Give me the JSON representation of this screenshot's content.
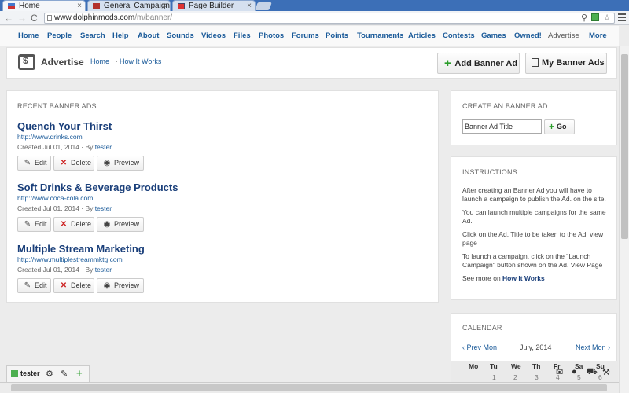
{
  "browser": {
    "tabs": [
      {
        "label": "Home",
        "active": true
      },
      {
        "label": "General Campaign",
        "active": false
      },
      {
        "label": "Page Builder",
        "active": false
      }
    ],
    "tab_close": "×",
    "back": "←",
    "forward": "→",
    "reload": "C",
    "url_host": "www.dolphinmods.com",
    "url_path": "/m/banner/",
    "zoom_icon": "⚲",
    "star": "☆"
  },
  "nav": {
    "items": [
      "Home",
      "People",
      "Search",
      "Help",
      "About",
      "Sounds",
      "Videos",
      "Files",
      "Photos",
      "Forums",
      "Points",
      "Tournaments",
      "Articles",
      "Contests",
      "Games",
      "Owned!",
      "Advertise",
      "More"
    ],
    "current": "Advertise"
  },
  "header": {
    "title": "Advertise",
    "breadcrumb": [
      "Home",
      "How It Works"
    ],
    "breadcrumb_sep": "·",
    "add_button": "Add Banner Ad",
    "my_button": "My Banner Ads"
  },
  "recent": {
    "heading": "RECENT BANNER ADS",
    "by_label": "By",
    "edit_label": "Edit",
    "delete_label": "Delete",
    "preview_label": "Preview",
    "ads": [
      {
        "title": "Quench Your Thirst",
        "url": "http://www.drinks.com",
        "created": "Created Jul 01, 2014",
        "author": "tester"
      },
      {
        "title": "Soft Drinks & Beverage Products",
        "url": "http://www.coca-cola.com",
        "created": "Created Jul 01, 2014",
        "author": "tester"
      },
      {
        "title": "Multiple Stream Marketing",
        "url": "http://www.multiplestreammktg.com",
        "created": "Created Jul 01, 2014",
        "author": "tester"
      }
    ]
  },
  "create": {
    "heading": "CREATE AN BANNER AD",
    "input_value": "Banner Ad Title",
    "go_label": "Go"
  },
  "instructions": {
    "heading": "INSTRUCTIONS",
    "p1": "After creating an Banner Ad you will have to launch a campaign to publish the Ad. on the site.",
    "p2": "You can launch multiple campaigns for the same Ad.",
    "p3": "Click on the Ad. Title to be taken to the Ad. view page",
    "p4": "To launch a campaign, click on the \"Launch Campaign\" button shown on the Ad. View Page",
    "see_more": "See more on",
    "see_more_link": "How It Works"
  },
  "calendar": {
    "heading": "CALENDAR",
    "prev": "‹ Prev Mon",
    "month": "July, 2014",
    "next": "Next Mon ›",
    "day_headers": [
      "Mo",
      "Tu",
      "We",
      "Th",
      "Fr",
      "Sa",
      "Su"
    ],
    "first_row": [
      "",
      "1",
      "2",
      "3",
      "4",
      "5",
      "6"
    ]
  },
  "userbar": {
    "username": "tester"
  },
  "colors": {
    "link": "#1a5a99",
    "title": "#1a3f7a",
    "green": "#2a9d2a",
    "delete_red": "#cc2222"
  }
}
